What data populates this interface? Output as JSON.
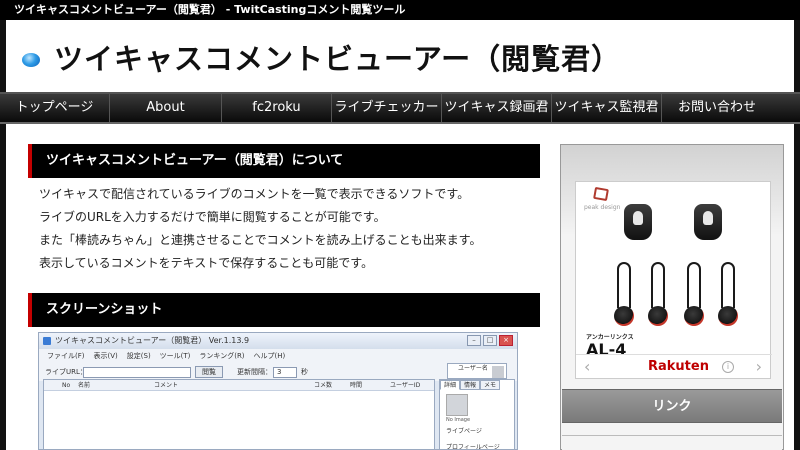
{
  "topbar": {
    "text": "ツイキャスコメントビューアー（閲覧君） - TwitCastingコメント閲覧ツール"
  },
  "header": {
    "title": "ツイキャスコメントビューアー（閲覧君）"
  },
  "nav": {
    "items": [
      {
        "label": "トップページ"
      },
      {
        "label": "About"
      },
      {
        "label": "fc2roku"
      },
      {
        "label": "ライブチェッカー"
      },
      {
        "label": "ツイキャス録画君"
      },
      {
        "label": "ツイキャス監視君"
      },
      {
        "label": "お問い合わせ"
      }
    ]
  },
  "about": {
    "heading": "ツイキャスコメントビューアー（閲覧君）について",
    "lines": [
      "ツイキャスで配信されているライブのコメントを一覧で表示できるソフトです。",
      "ライブのURLを入力するだけで簡単に閲覧することが可能です。",
      "また「棒読みちゃん」と連携させることでコメントを読み上げることも出来ます。",
      "表示しているコメントをテキストで保存することも可能です。"
    ]
  },
  "screenshot": {
    "heading": "スクリーンショット",
    "app": {
      "title": "ツイキャスコメントビューアー（閲覧君） Ver.1.13.9",
      "menu": [
        "ファイル(F)",
        "表示(V)",
        "設定(S)",
        "ツール(T)",
        "ランキング(R)",
        "ヘルプ(H)"
      ],
      "url_label": "ライブURL：",
      "view_button": "閲覧",
      "interval_label": "更新間隔：",
      "interval_value": "3",
      "interval_unit": "秒",
      "columns": [
        "No",
        "名前",
        "コメント",
        "コメ数",
        "時間",
        "ユーザーID"
      ],
      "profile": "ユーザー名",
      "side_tabs": [
        "詳細",
        "情報",
        "メモ"
      ],
      "side_avatar_caption": "No Image",
      "side_link1": "ライブページ",
      "side_link2": "プロフィールページ"
    }
  },
  "sidebar": {
    "ad": {
      "brand": "peak design",
      "subtitle": "アンカーリンクス",
      "model": "AL-4",
      "shop": "Rakuten",
      "prev": "‹",
      "next": "›",
      "info": "i"
    },
    "link_label": "リンク"
  },
  "colors": {
    "accent_red": "#c40000",
    "rakuten_red": "#bf0000",
    "nav_bg": "#111111"
  }
}
